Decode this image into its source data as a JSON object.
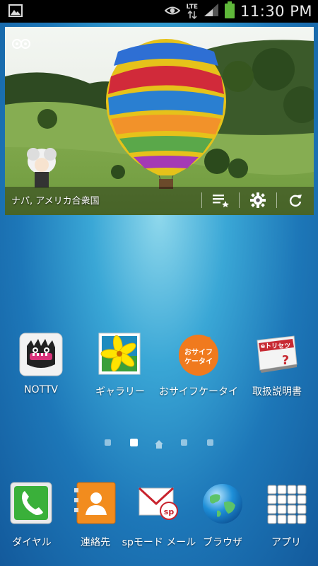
{
  "status_bar": {
    "time": "11:30 PM",
    "network": "LTE",
    "icons": [
      "image-notification-icon",
      "eye-icon",
      "lte-data-icon",
      "signal-icon",
      "battery-icon"
    ]
  },
  "widget": {
    "location": "ナパ, アメリカ合衆国",
    "actions": [
      "list-favorite-icon",
      "settings-gear-icon",
      "refresh-icon"
    ]
  },
  "home_apps": [
    {
      "label": "NOTTV",
      "icon": "nottv-icon"
    },
    {
      "label": "ギャラリー",
      "icon": "gallery-icon"
    },
    {
      "label": "おサイフケータイ",
      "icon": "osaifu-keitai-icon"
    },
    {
      "label": "取扱説明書",
      "icon": "manual-icon"
    }
  ],
  "page_indicator": {
    "pages": 5,
    "current": 2,
    "home_page": 3
  },
  "dock": [
    {
      "label": "ダイヤル",
      "icon": "phone-icon"
    },
    {
      "label": "連絡先",
      "icon": "contacts-icon"
    },
    {
      "label": "spモード メール",
      "icon": "sp-mail-icon"
    },
    {
      "label": "ブラウザ",
      "icon": "browser-globe-icon"
    },
    {
      "label": "アプリ",
      "icon": "apps-grid-icon"
    }
  ],
  "colors": {
    "accent_orange": "#f07a1e",
    "status_bar": "#000000",
    "battery_green": "#5fb83a"
  }
}
